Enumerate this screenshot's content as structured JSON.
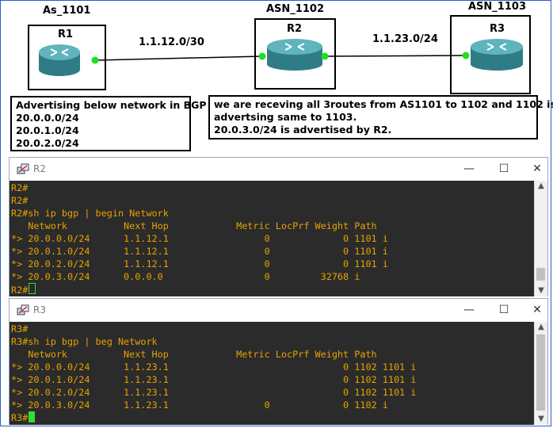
{
  "topology": {
    "as_labels": [
      "As_1101",
      "ASN_1102",
      "ASN_1103"
    ],
    "routers": [
      "R1",
      "R2",
      "R3"
    ],
    "links": [
      "1.1.12.0/30",
      "1.1.23.0/24"
    ],
    "note_left": {
      "title": "Advertising below network in BGP",
      "lines": [
        "20.0.0.0/24",
        "20.0.1.0/24",
        "20.0.2.0/24"
      ]
    },
    "note_right": {
      "lines": [
        "we are receving all 3routes from AS1101 to 1102 and 1102 is",
        "advertsing same to 1103.",
        "20.0.3.0/24 is advertised by R2."
      ]
    },
    "colors": {
      "link_dot": "#22dd22",
      "router_body": "#3a8f99",
      "box_border": "#000000"
    }
  },
  "r2_window": {
    "title": "R2",
    "icon": "putty-icon",
    "lines": [
      "R2#",
      "R2#",
      "R2#sh ip bgp | begin Network",
      "   Network          Next Hop            Metric LocPrf Weight Path",
      "*> 20.0.0.0/24      1.1.12.1                 0             0 1101 i",
      "*> 20.0.1.0/24      1.1.12.1                 0             0 1101 i",
      "*> 20.0.2.0/24      1.1.12.1                 0             0 1101 i",
      "*> 20.0.3.0/24      0.0.0.0                  0         32768 i",
      "R2#"
    ]
  },
  "r3_window": {
    "title": "R3",
    "icon": "putty-icon",
    "lines": [
      "R3#",
      "R3#sh ip bgp | beg Network",
      "   Network          Next Hop            Metric LocPrf Weight Path",
      "*> 20.0.0.0/24      1.1.23.1                               0 1102 1101 i",
      "*> 20.0.1.0/24      1.1.23.1                               0 1102 1101 i",
      "*> 20.0.2.0/24      1.1.23.1                               0 1102 1101 i",
      "*> 20.0.3.0/24      1.1.23.1                 0             0 1102 i",
      "R3#"
    ]
  },
  "window_controls": {
    "minimize": "—",
    "maximize": "☐",
    "close": "✕"
  }
}
